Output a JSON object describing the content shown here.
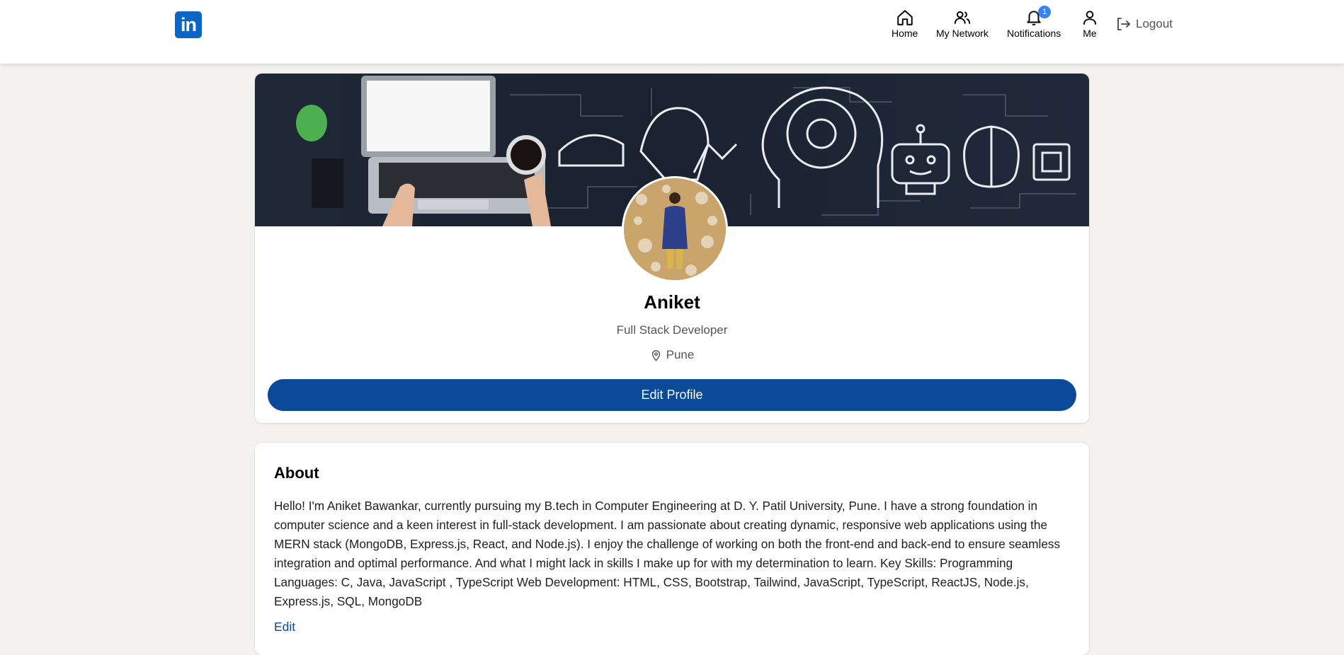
{
  "nav": {
    "logo_text": "in",
    "items": [
      {
        "label": "Home",
        "icon": "home-icon"
      },
      {
        "label": "My Network",
        "icon": "network-icon"
      },
      {
        "label": "Notifications",
        "icon": "bell-icon",
        "badge": "1"
      },
      {
        "label": "Me",
        "icon": "user-icon"
      }
    ],
    "logout_label": "Logout"
  },
  "profile": {
    "name": "Aniket",
    "headline": "Full Stack Developer",
    "location": "Pune",
    "edit_button": "Edit Profile"
  },
  "about": {
    "title": "About",
    "text": "Hello! I'm Aniket Bawankar, currently pursuing my B.tech in Computer Engineering at D. Y. Patil University, Pune. I have a strong foundation in computer science and a keen interest in full-stack development. I am passionate about creating dynamic, responsive web applications using the MERN stack (MongoDB, Express.js, React, and Node.js). I enjoy the challenge of working on both the front-end and back-end to ensure seamless integration and optimal performance. And what I might lack in skills I make up for with my determination to learn. Key Skills: Programming Languages: C, Java, JavaScript , TypeScript Web Development: HTML, CSS, Bootstrap, Tailwind, JavaScript, TypeScript, ReactJS, Node.js, Express.js, SQL, MongoDB",
    "edit_link": "Edit"
  },
  "colors": {
    "brand": "#0a66c2",
    "button": "#0a4a98",
    "badge": "#3b82f6",
    "background": "#f3f2ef"
  }
}
